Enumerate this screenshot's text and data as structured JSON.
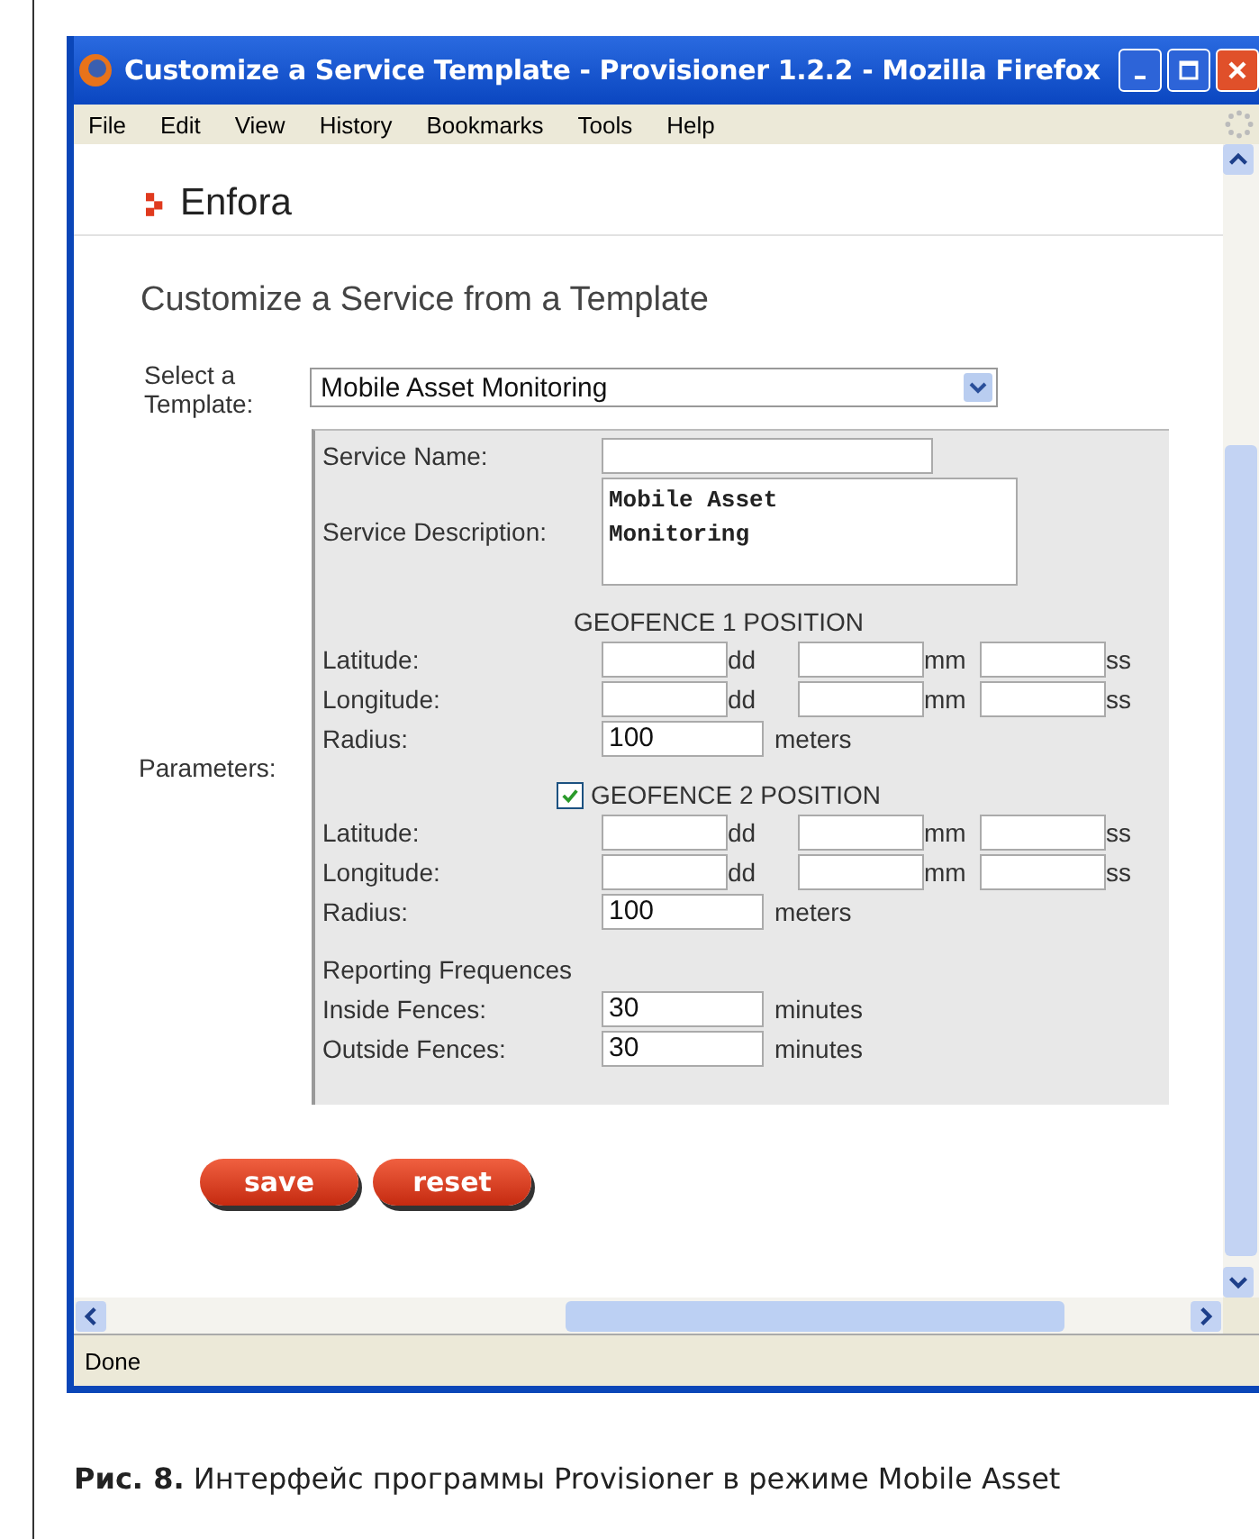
{
  "window": {
    "title": "Customize a Service Template - Provisioner 1.2.2 - Mozilla Firefox"
  },
  "menu": [
    "File",
    "Edit",
    "View",
    "History",
    "Bookmarks",
    "Tools",
    "Help"
  ],
  "brand": "Enfora",
  "heading": "Customize a Service from a Template",
  "template": {
    "label": "Select a Template:",
    "value": "Mobile Asset Monitoring"
  },
  "parameters_label": "Parameters:",
  "service": {
    "name_label": "Service Name:",
    "description_label": "Service Description:",
    "description": "Mobile Asset\nMonitoring"
  },
  "geofences": [
    {
      "title": "GEOFENCE 1 POSITION",
      "rows": [
        {
          "label": "Latitude:",
          "fields": [
            {
              "unit": "dd"
            },
            {
              "unit": "mm"
            },
            {
              "unit": "ss"
            }
          ]
        },
        {
          "label": "Longitude:",
          "fields": [
            {
              "unit": "dd"
            },
            {
              "unit": "mm"
            },
            {
              "unit": "ss"
            }
          ]
        },
        {
          "label": "Radius:",
          "fields": [
            {
              "value": "100",
              "unit": "meters"
            }
          ]
        }
      ]
    },
    {
      "title": "GEOFENCE 2 POSITION",
      "checked": true,
      "rows": [
        {
          "label": "Latitude:",
          "fields": [
            {
              "unit": "dd"
            },
            {
              "unit": "mm"
            },
            {
              "unit": "ss"
            }
          ]
        },
        {
          "label": "Longitude:",
          "fields": [
            {
              "unit": "dd"
            },
            {
              "unit": "mm"
            },
            {
              "unit": "ss"
            }
          ]
        },
        {
          "label": "Radius:",
          "fields": [
            {
              "value": "100",
              "unit": "meters"
            }
          ]
        }
      ]
    }
  ],
  "reporting": {
    "title": "Reporting Frequences",
    "rows": [
      {
        "label": "Inside Fences:",
        "fields": [
          {
            "value": "30",
            "unit": "minutes"
          }
        ]
      },
      {
        "label": "Outside Fences:",
        "fields": [
          {
            "value": "30",
            "unit": "minutes"
          }
        ]
      }
    ]
  },
  "buttons": [
    "save",
    "reset"
  ],
  "status_bar": "Done",
  "caption": "**Рис. 8.** Интерфейс программы Provisioner в режиме Mobile Asset"
}
